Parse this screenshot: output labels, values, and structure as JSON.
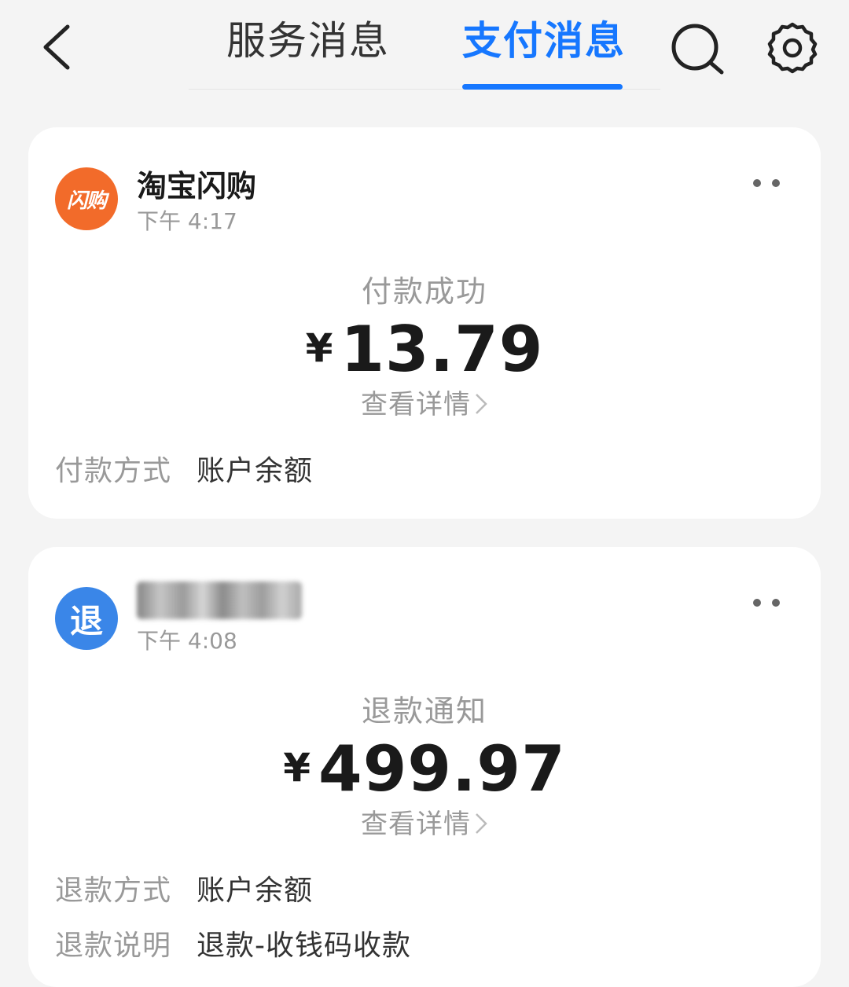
{
  "header": {
    "back_icon": "chevron-left-icon",
    "tabs": [
      {
        "label": "服务消息",
        "active": false
      },
      {
        "label": "支付消息",
        "active": true
      }
    ],
    "search_icon": "search-icon",
    "settings_icon": "gear-icon",
    "accent_color": "#1677ff"
  },
  "messages": [
    {
      "avatar_text": "闪购",
      "avatar_color": "#f26b2a",
      "sender": "淘宝闪购",
      "time": "下午 4:17",
      "status": "付款成功",
      "currency": "¥",
      "amount": "13.79",
      "detail_link": "查看详情",
      "details": [
        {
          "label": "付款方式",
          "value": "账户余额"
        }
      ]
    },
    {
      "avatar_text": "退",
      "avatar_color": "#3a86e8",
      "sender": "",
      "sender_blurred": true,
      "time": "下午 4:08",
      "status": "退款通知",
      "currency": "¥",
      "amount": "499.97",
      "detail_link": "查看详情",
      "details": [
        {
          "label": "退款方式",
          "value": "账户余额"
        },
        {
          "label": "退款说明",
          "value": "退款-收钱码收款"
        }
      ]
    }
  ]
}
